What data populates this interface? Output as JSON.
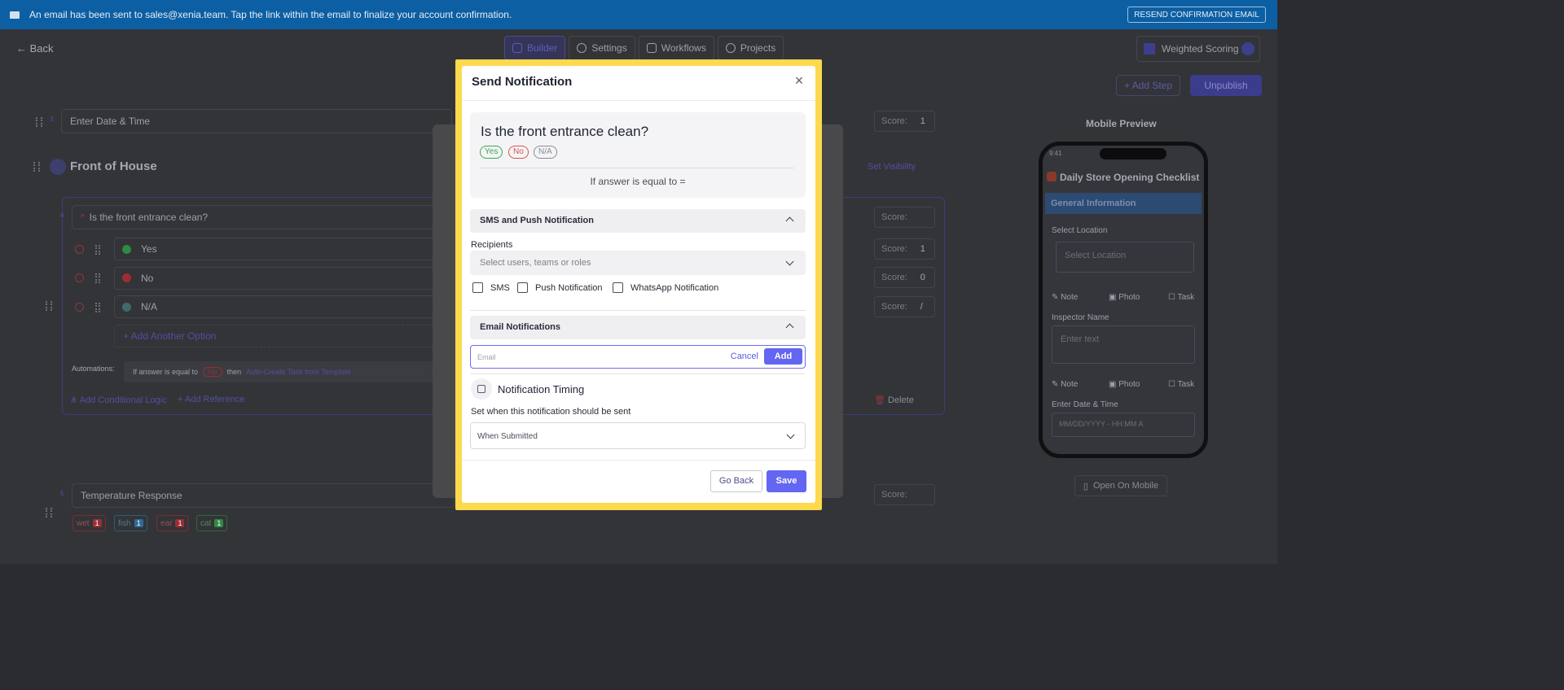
{
  "banner": {
    "message": "An email has been sent to sales@xenia.team. Tap the link within the email to finalize your account confirmation.",
    "resend_label": "RESEND CONFIRMATION EMAIL"
  },
  "nav": {
    "back_label": "Back",
    "tabs": [
      "Builder",
      "Settings",
      "Workflows",
      "Projects"
    ],
    "weighted_scoring_label": "Weighted Scoring",
    "add_step_label": "+ Add Step",
    "unpublish_label": "Unpublish"
  },
  "builder": {
    "step3_label": "Enter Date & Time",
    "step3_number": "3",
    "score_label": "Score:",
    "step3_score": "1",
    "section_title": "Front of House",
    "set_visibility_label": "Set Visibility",
    "question_number": "4",
    "question_text": "Is the front entrance clean?",
    "options": [
      {
        "label": "Yes",
        "score": "1",
        "color": "#2f8a43"
      },
      {
        "label": "No",
        "score": "0",
        "color": "#9a2e33"
      },
      {
        "label": "N/A",
        "score": "/",
        "color": "#3e6a6a"
      }
    ],
    "add_option_label": "+ Add Another Option",
    "automations_label": "Automations:",
    "automation_rule": "If answer is equal to",
    "automation_value": "No",
    "automation_then": "then",
    "automation_action": "Auto-Create Task from Template",
    "add_conditional_label": "Add Conditional Logic",
    "add_reference_label": "Add Reference",
    "delete_label": "Delete",
    "step5_number": "5",
    "step5_label": "Temperature Response",
    "temp_chips": [
      {
        "label": "wet",
        "count": "1",
        "color": "#9a2e33"
      },
      {
        "label": "fish",
        "count": "1",
        "color": "#2f6a9a"
      },
      {
        "label": "ear",
        "count": "1",
        "color": "#9a2e33"
      },
      {
        "label": "cat",
        "count": "1",
        "color": "#2f8a43"
      }
    ]
  },
  "mobile_preview": {
    "title": "Mobile Preview",
    "time": "9:41",
    "checklist_title": "Daily Store Opening Checklist",
    "section": "General Information",
    "select_location_label": "Select Location",
    "select_location_placeholder": "Select Location",
    "note_label": "Note",
    "photo_label": "Photo",
    "task_label": "Task",
    "inspector_label": "Inspector Name",
    "inspector_placeholder": "Enter text",
    "date_label": "Enter Date & Time",
    "date_placeholder": "MM/DD/YYYY - HH:MM A",
    "open_on_mobile_label": "Open On Mobile"
  },
  "modal": {
    "title": "Send Notification",
    "question": "Is the front entrance clean?",
    "answers": [
      {
        "label": "Yes",
        "color": "#3aa852"
      },
      {
        "label": "No",
        "color": "#d9534f"
      },
      {
        "label": "N/A",
        "color": "#8a8d96"
      }
    ],
    "condition": "If answer is equal to =",
    "sms_section_title": "SMS and Push Notification",
    "recipients_label": "Recipients",
    "recipients_placeholder": "Select users, teams or roles",
    "channels": [
      "SMS",
      "Push Notification",
      "WhatsApp Notification"
    ],
    "email_section_title": "Email Notifications",
    "email_placeholder": "Email",
    "email_cancel_label": "Cancel",
    "email_add_label": "Add",
    "timing_title": "Notification Timing",
    "timing_subtitle": "Set when this notification should be sent",
    "timing_value": "When Submitted",
    "go_back_label": "Go Back",
    "save_label": "Save"
  },
  "colors": {
    "banner": "#0c5fa3",
    "accent": "#6366f1",
    "highlight_frame": "#fdd94d"
  }
}
